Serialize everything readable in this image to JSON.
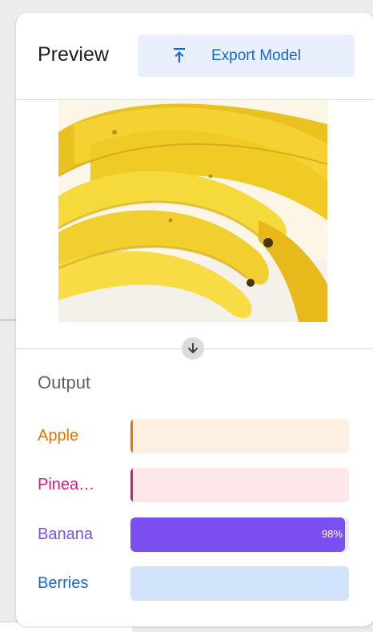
{
  "header": {
    "title": "Preview",
    "export_label": "Export Model"
  },
  "output": {
    "title": "Output",
    "classes": [
      {
        "label": "Apple",
        "color": "#e37400",
        "track_color": "#feefe3",
        "confidence": 0.01,
        "pct_text": ""
      },
      {
        "label": "Pinea…",
        "color": "#d01884",
        "track_color": "#fde7e9",
        "confidence": 0.01,
        "pct_text": ""
      },
      {
        "label": "Banana",
        "color": "#7b4ff0",
        "track_color": "#efe9fd",
        "confidence": 0.98,
        "pct_text": "98%"
      },
      {
        "label": "Berries",
        "color": "#1967d2",
        "track_color": "#d2e3fc",
        "confidence": 0.0,
        "pct_text": ""
      }
    ]
  },
  "icons": {
    "export": "upload-arrow-icon",
    "flow": "arrow-down-icon"
  }
}
